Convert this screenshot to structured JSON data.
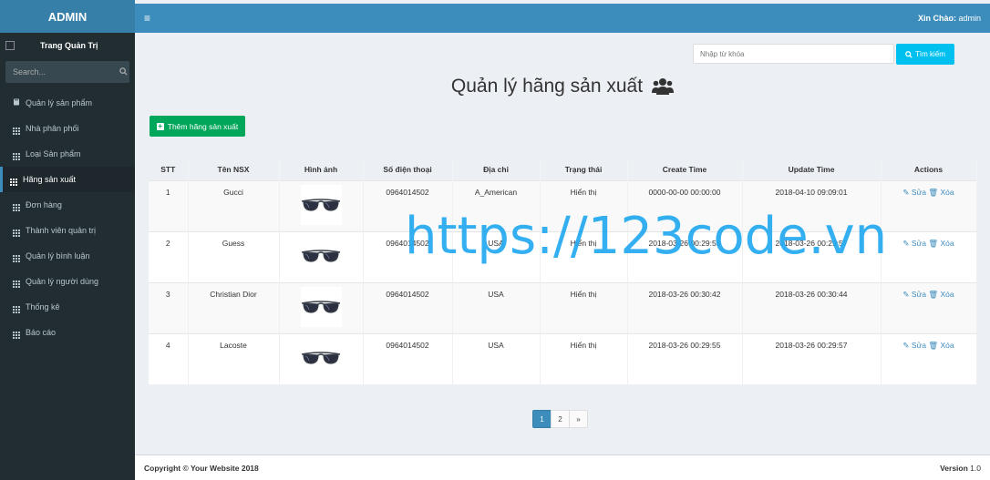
{
  "sidebar": {
    "logo": "ADMIN",
    "user_panel": "Trang Quản Trị",
    "search_placeholder": "Search...",
    "items": [
      {
        "label": "Quản lý sản phẩm",
        "icon": "book-icon"
      },
      {
        "label": "Nhà phân phối",
        "icon": "grid-icon"
      },
      {
        "label": "Loại Sản phẩm",
        "icon": "grid-icon"
      },
      {
        "label": "Hãng sản xuất",
        "icon": "grid-icon",
        "active": true
      },
      {
        "label": "Đơn hàng",
        "icon": "grid-icon"
      },
      {
        "label": "Thành viên quản trị",
        "icon": "grid-icon"
      },
      {
        "label": "Quản lý bình luận",
        "icon": "grid-icon"
      },
      {
        "label": "Quản lý người dùng",
        "icon": "grid-icon"
      },
      {
        "label": "Thống kê",
        "icon": "grid-icon"
      },
      {
        "label": "Báo cáo",
        "icon": "grid-icon"
      }
    ]
  },
  "header": {
    "greeting_label": "Xin Chào:",
    "username": "admin"
  },
  "search": {
    "placeholder": "Nhập từ khóa",
    "button_label": "Tìm kiếm"
  },
  "page": {
    "title": "Quản lý hãng sản xuất",
    "add_button_label": "Thêm hãng sản xuất"
  },
  "table": {
    "columns": [
      "STT",
      "Tên NSX",
      "Hình ảnh",
      "Số điện thoại",
      "Địa chỉ",
      "Trạng thái",
      "Create Time",
      "Update Time",
      "Actions"
    ],
    "rows": [
      {
        "stt": "1",
        "name": "Gucci",
        "phone": "0964014502",
        "address": "A_American",
        "status": "Hiển thị",
        "create": "0000-00-00 00:00:00",
        "update": "2018-04-10 09:09:01"
      },
      {
        "stt": "2",
        "name": "Guess",
        "phone": "0964014502",
        "address": "USA",
        "status": "Hiển thị",
        "create": "2018-03-26 00:29:55",
        "update": "2018-03-26 00:29:57"
      },
      {
        "stt": "3",
        "name": "Christian Dior",
        "phone": "0964014502",
        "address": "USA",
        "status": "Hiển thị",
        "create": "2018-03-26 00:30:42",
        "update": "2018-03-26 00:30:44"
      },
      {
        "stt": "4",
        "name": "Lacoste",
        "phone": "0964014502",
        "address": "USA",
        "status": "Hiển thị",
        "create": "2018-03-26 00:29:55",
        "update": "2018-03-26 00:29:57"
      }
    ],
    "edit_label": "Sửa",
    "delete_label": "Xóa"
  },
  "pagination": {
    "pages": [
      "1",
      "2"
    ],
    "next": "»",
    "current": "1"
  },
  "watermark": "https://123code.vn",
  "footer": {
    "copyright": "Copyright © Your Website 2018",
    "version_label": "Version",
    "version_number": "1.0"
  },
  "colors": {
    "sidebar_bg": "#222d32",
    "header_bg": "#3c8dbc",
    "logo_bg": "#367fa9",
    "add_button": "#00a65a",
    "search_button": "#00c0ef",
    "watermark": "#23a9f0"
  }
}
